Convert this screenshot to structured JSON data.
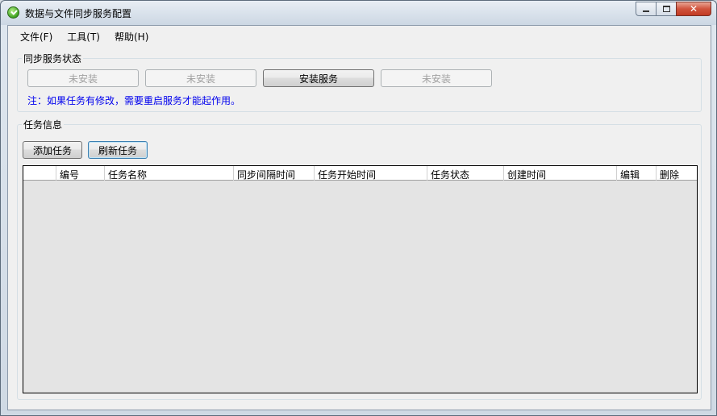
{
  "window": {
    "title": "数据与文件同步服务配置",
    "minimize_label": "",
    "maximize_label": "",
    "close_label": "✕"
  },
  "menu": {
    "items": [
      {
        "label": "文件(F)"
      },
      {
        "label": "工具(T)"
      },
      {
        "label": "帮助(H)"
      }
    ]
  },
  "service_status": {
    "title": "同步服务状态",
    "buttons": [
      {
        "label": "未安装",
        "enabled": false
      },
      {
        "label": "未安装",
        "enabled": false
      },
      {
        "label": "安装服务",
        "enabled": true
      },
      {
        "label": "未安装",
        "enabled": false
      }
    ],
    "note": "注：如果任务有修改，需要重启服务才能起作用。"
  },
  "task_info": {
    "title": "任务信息",
    "add_label": "添加任务",
    "refresh_label": "刷新任务",
    "columns": [
      {
        "label": ""
      },
      {
        "label": "编号"
      },
      {
        "label": "任务名称"
      },
      {
        "label": "同步间隔时间"
      },
      {
        "label": "任务开始时间"
      },
      {
        "label": "任务状态"
      },
      {
        "label": "创建时间"
      },
      {
        "label": "编辑"
      },
      {
        "label": "删除"
      }
    ],
    "rows": []
  },
  "colors": {
    "note": "#0000ee",
    "close_button": "#c13b24",
    "grid_background": "#e4e4e4"
  }
}
